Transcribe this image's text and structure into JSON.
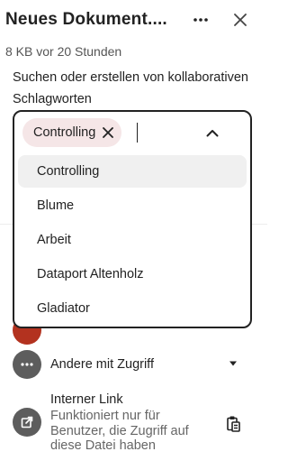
{
  "header": {
    "title": "Neues Dokument....",
    "subtitle": "8 KB vor 20 Stunden",
    "more_icon": "more-horizontal-icon",
    "close_icon": "close-icon"
  },
  "tags": {
    "description": "Suchen oder erstellen von kollaborativen Schlagworten",
    "selected_tag": "Controlling",
    "search_value": "",
    "toggle_icon": "chevron-up-icon",
    "options": [
      {
        "label": "Controlling"
      },
      {
        "label": "Blume"
      },
      {
        "label": "Arbeit"
      },
      {
        "label": "Dataport Altenholz"
      },
      {
        "label": "Gladiator"
      }
    ]
  },
  "sharing": {
    "others_label": "Andere mit Zugriff",
    "internal_link": {
      "title": "Interner Link",
      "description": "Funktioniert nur für Benutzer, die Zugriff auf diese Datei haben"
    }
  },
  "colors": {
    "chip_bg": "#f5e6e7",
    "option_highlight": "#f0f0f0",
    "icon_bg": "#5d5d5d",
    "avatar_bg": "#b3321f"
  }
}
